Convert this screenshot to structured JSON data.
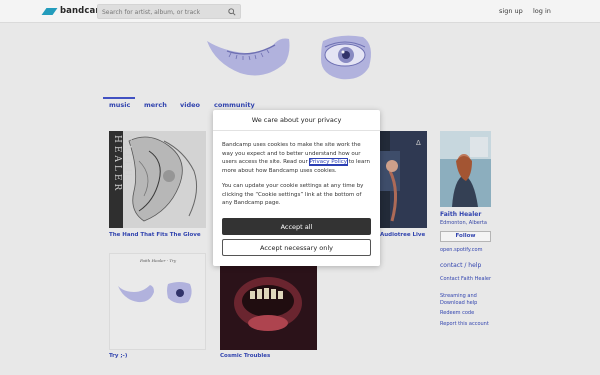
{
  "topbar": {
    "logo_text": "bandcamp",
    "search_placeholder": "Search for artist, album, or track",
    "signup": "sign up",
    "login": "log in"
  },
  "tabs": [
    {
      "label": "music",
      "active": true
    },
    {
      "label": "merch"
    },
    {
      "label": "video"
    },
    {
      "label": "community"
    }
  ],
  "albums": [
    {
      "title": "The Hand That Fits The Glove",
      "cover_text": "FAITH HEALER"
    },
    {
      "title": "Audiotree Live"
    },
    {
      "title": "Try ;-)",
      "cover_text": "Faith Healer - Try"
    },
    {
      "title": "Cosmic Troubles"
    }
  ],
  "sidebar": {
    "artist_name": "Faith Healer",
    "location": "Edmonton, Alberta",
    "follow_label": "Follow",
    "links": [
      "open.spotify.com"
    ],
    "contact_heading": "contact / help",
    "contact_links": [
      "Contact Faith Healer",
      "Streaming and Download help",
      "Redeem code",
      "Report this account"
    ]
  },
  "modal": {
    "title": "We care about your privacy",
    "body_before_link": "Bandcamp uses cookies to make the site work the way you expect and to better understand how our users access the site. Read our ",
    "link_text": "Privacy Policy",
    "body_after_link": " to learn more about how Bandcamp uses cookies.",
    "body2": "You can update your cookie settings at any time by clicking the “Cookie settings” link at the bottom of any Bandcamp page.",
    "accept_all": "Accept all",
    "accept_necessary": "Accept necessary only"
  },
  "colors": {
    "link_blue": "#2b3fb4",
    "brand_blue": "#1da0c3",
    "art_lavender": "#b7b8e6"
  },
  "icons": [
    "search-icon",
    "bandcamp-logo-icon"
  ]
}
